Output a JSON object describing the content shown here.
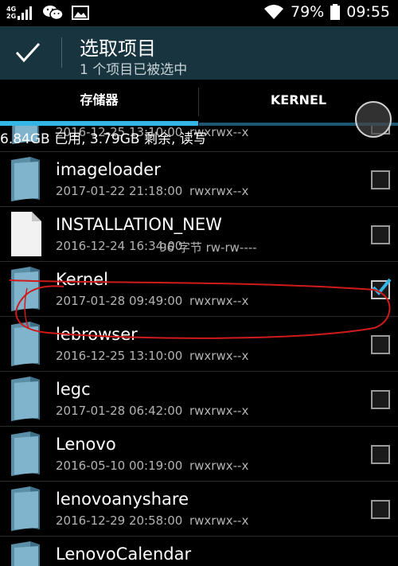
{
  "status_bar": {
    "network": [
      "4G",
      "2G"
    ],
    "battery": "79%",
    "time": "09:55",
    "icons": [
      "signal-icon",
      "wechat-icon",
      "gallery-icon",
      "wifi-icon",
      "battery-icon"
    ]
  },
  "action_bar": {
    "title": "选取项目",
    "subtitle": "1 个项目已被选中",
    "confirm_icon": "check-icon"
  },
  "tabs": [
    {
      "label": "存储器",
      "active": true
    },
    {
      "label": "KERNEL",
      "active": false
    }
  ],
  "storage_info": "6.84GB 已用, 3.79GB 剩余, 读写",
  "files": [
    {
      "name": "",
      "date": "2016-12-25 13:10:00",
      "perm": "rwxrwx--x",
      "type": "folder",
      "selected": false
    },
    {
      "name": "imageloader",
      "date": "2017-01-22 21:18:00",
      "perm": "rwxrwx--x",
      "type": "folder",
      "selected": false
    },
    {
      "name": "INSTALLATION_NEW",
      "date": "2016-12-24 16:34:00",
      "perm": "96 字节  rw-rw----",
      "type": "file",
      "selected": false
    },
    {
      "name": "Kernel",
      "date": "2017-01-28 09:49:00",
      "perm": "rwxrwx--x",
      "type": "folder",
      "selected": true
    },
    {
      "name": "lebrowser",
      "date": "2016-12-25 13:10:00",
      "perm": "rwxrwx--x",
      "type": "folder",
      "selected": false
    },
    {
      "name": "legc",
      "date": "2017-01-28 06:42:00",
      "perm": "rwxrwx--x",
      "type": "folder",
      "selected": false
    },
    {
      "name": "Lenovo",
      "date": "2016-05-10 00:19:00",
      "perm": "rwxrwx--x",
      "type": "folder",
      "selected": false
    },
    {
      "name": "lenovoanyshare",
      "date": "2016-12-29 20:58:00",
      "perm": "rwxrwx--x",
      "type": "folder",
      "selected": false
    },
    {
      "name": "LenovoCalendar",
      "date": "",
      "perm": "",
      "type": "folder",
      "selected": false
    }
  ],
  "colors": {
    "action_bar": "#17343f",
    "accent": "#33b5e5",
    "annotation": "#d11a1a"
  }
}
